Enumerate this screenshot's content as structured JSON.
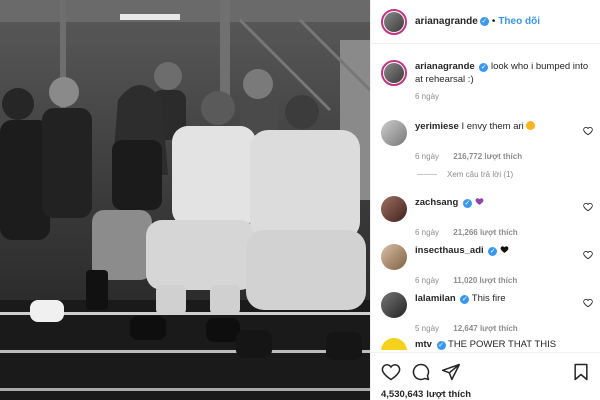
{
  "post": {
    "author": "arianagrande",
    "follow_label": "Theo dõi",
    "separator": "•",
    "caption": {
      "username": "arianagrande",
      "text": "look who i bumped into at rehearsal :)",
      "time": "6 ngày"
    },
    "comments": [
      {
        "username": "yerimiese",
        "text": "I envy them ari",
        "time": "6 ngày",
        "likes": "216,772 lượt thích",
        "verified": false
      },
      {
        "username": "zachsang",
        "text": "",
        "time": "6 ngày",
        "likes": "21,266 lượt thích",
        "verified": true
      },
      {
        "username": "insecthaus_adi",
        "text": "",
        "time": "6 ngày",
        "likes": "11,020 lượt thích",
        "verified": true
      },
      {
        "username": "lalamilan",
        "text": "This fire",
        "time": "5 ngày",
        "likes": "12,647 lượt thích",
        "verified": true
      },
      {
        "username": "mtv",
        "text": "THE POWER THAT THIS",
        "verified": true
      }
    ],
    "view_replies": "Xem câu trả lời (1)",
    "like_count": "4,530,643",
    "like_suffix": "lượt thích",
    "verified_mark": "✓",
    "colors": {
      "accent": "#3897f0",
      "muted": "#8e8e8e",
      "emoji_heart": "#8e44ad",
      "black_heart": "#111111",
      "smile_emoji": "#f5b623"
    },
    "icons": [
      "heart-icon",
      "comment-icon",
      "share-icon",
      "bookmark-icon"
    ]
  }
}
